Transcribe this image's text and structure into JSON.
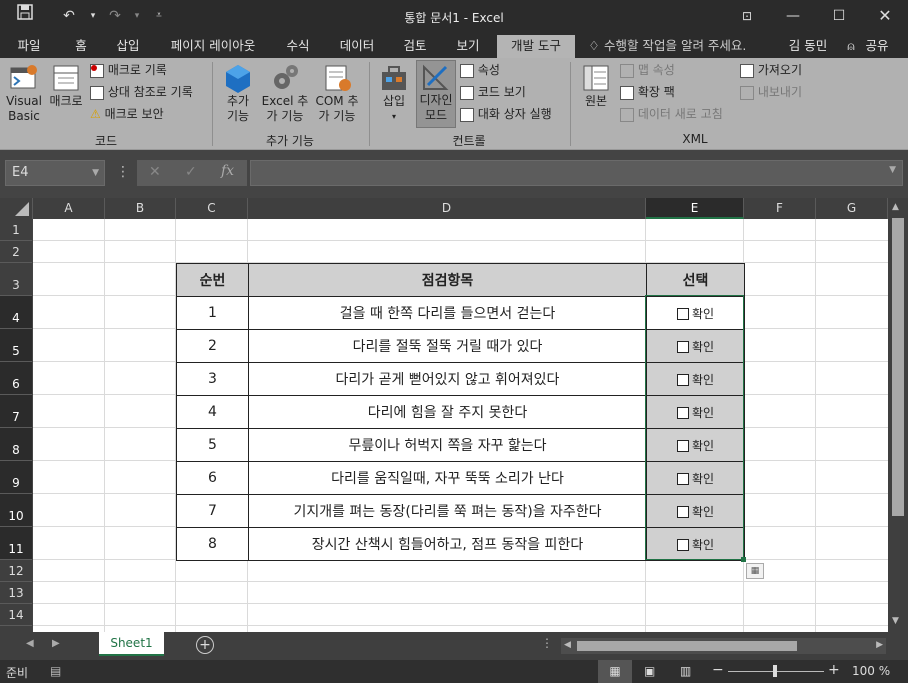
{
  "window": {
    "title": "통합 문서1 - Excel"
  },
  "tabs": [
    "파일",
    "홈",
    "삽입",
    "페이지 레이아웃",
    "수식",
    "데이터",
    "검토",
    "보기",
    "개발 도구"
  ],
  "tell_me": "수행할 작업을 알려 주세요.",
  "user": "김 동민",
  "share": "공유",
  "ribbon": {
    "visual_basic": "Visual Basic",
    "macro": "매크로",
    "record_macro": "매크로 기록",
    "relative_ref": "상대 참조로 기록",
    "macro_security": "매크로 보안",
    "group_code": "코드",
    "addins": "추가 기능",
    "excel_addins": "Excel 추가 기능",
    "com_addins": "COM 추가 기능",
    "group_addins": "추가 기능",
    "insert": "삽입",
    "design_mode": "디자인 모드",
    "properties": "속성",
    "view_code": "코드 보기",
    "run_dialog": "대화 상자 실행",
    "group_controls": "컨트롤",
    "source": "원본",
    "map_props": "맵 속성",
    "expansion_packs": "확장 팩",
    "refresh_data": "데이터 새로 고침",
    "import": "가져오기",
    "export": "내보내기",
    "group_xml": "XML"
  },
  "namebox": "E4",
  "columns": [
    "A",
    "B",
    "C",
    "D",
    "E",
    "F",
    "G"
  ],
  "rows": [
    "1",
    "2",
    "3",
    "4",
    "5",
    "6",
    "7",
    "8",
    "9",
    "10",
    "11",
    "12",
    "13",
    "14"
  ],
  "table": {
    "headers": [
      "순번",
      "점검항목",
      "선택"
    ],
    "rows": [
      {
        "no": "1",
        "item": "걸을 때 한쪽 다리를 들으면서 걷는다",
        "check": "확인"
      },
      {
        "no": "2",
        "item": "다리를 절뚝 절뚝 거릴 때가 있다",
        "check": "확인"
      },
      {
        "no": "3",
        "item": "다리가 곧게 뻗어있지 않고 휘어져있다",
        "check": "확인"
      },
      {
        "no": "4",
        "item": "다리에 힘을 잘 주지 못한다",
        "check": "확인"
      },
      {
        "no": "5",
        "item": "무릎이나 허벅지 쪽을 자꾸 핥는다",
        "check": "확인"
      },
      {
        "no": "6",
        "item": "다리를 움직일때, 자꾸 뚝뚝 소리가 난다",
        "check": "확인"
      },
      {
        "no": "7",
        "item": "기지개를 펴는 동장(다리를 쭉 펴는 동작)을 자주한다",
        "check": "확인"
      },
      {
        "no": "8",
        "item": "장시간 산책시 힘들어하고, 점프 동작을 피한다",
        "check": "확인"
      }
    ]
  },
  "sheet_tab": "Sheet1",
  "status": {
    "ready": "준비",
    "zoom": "100 %"
  }
}
